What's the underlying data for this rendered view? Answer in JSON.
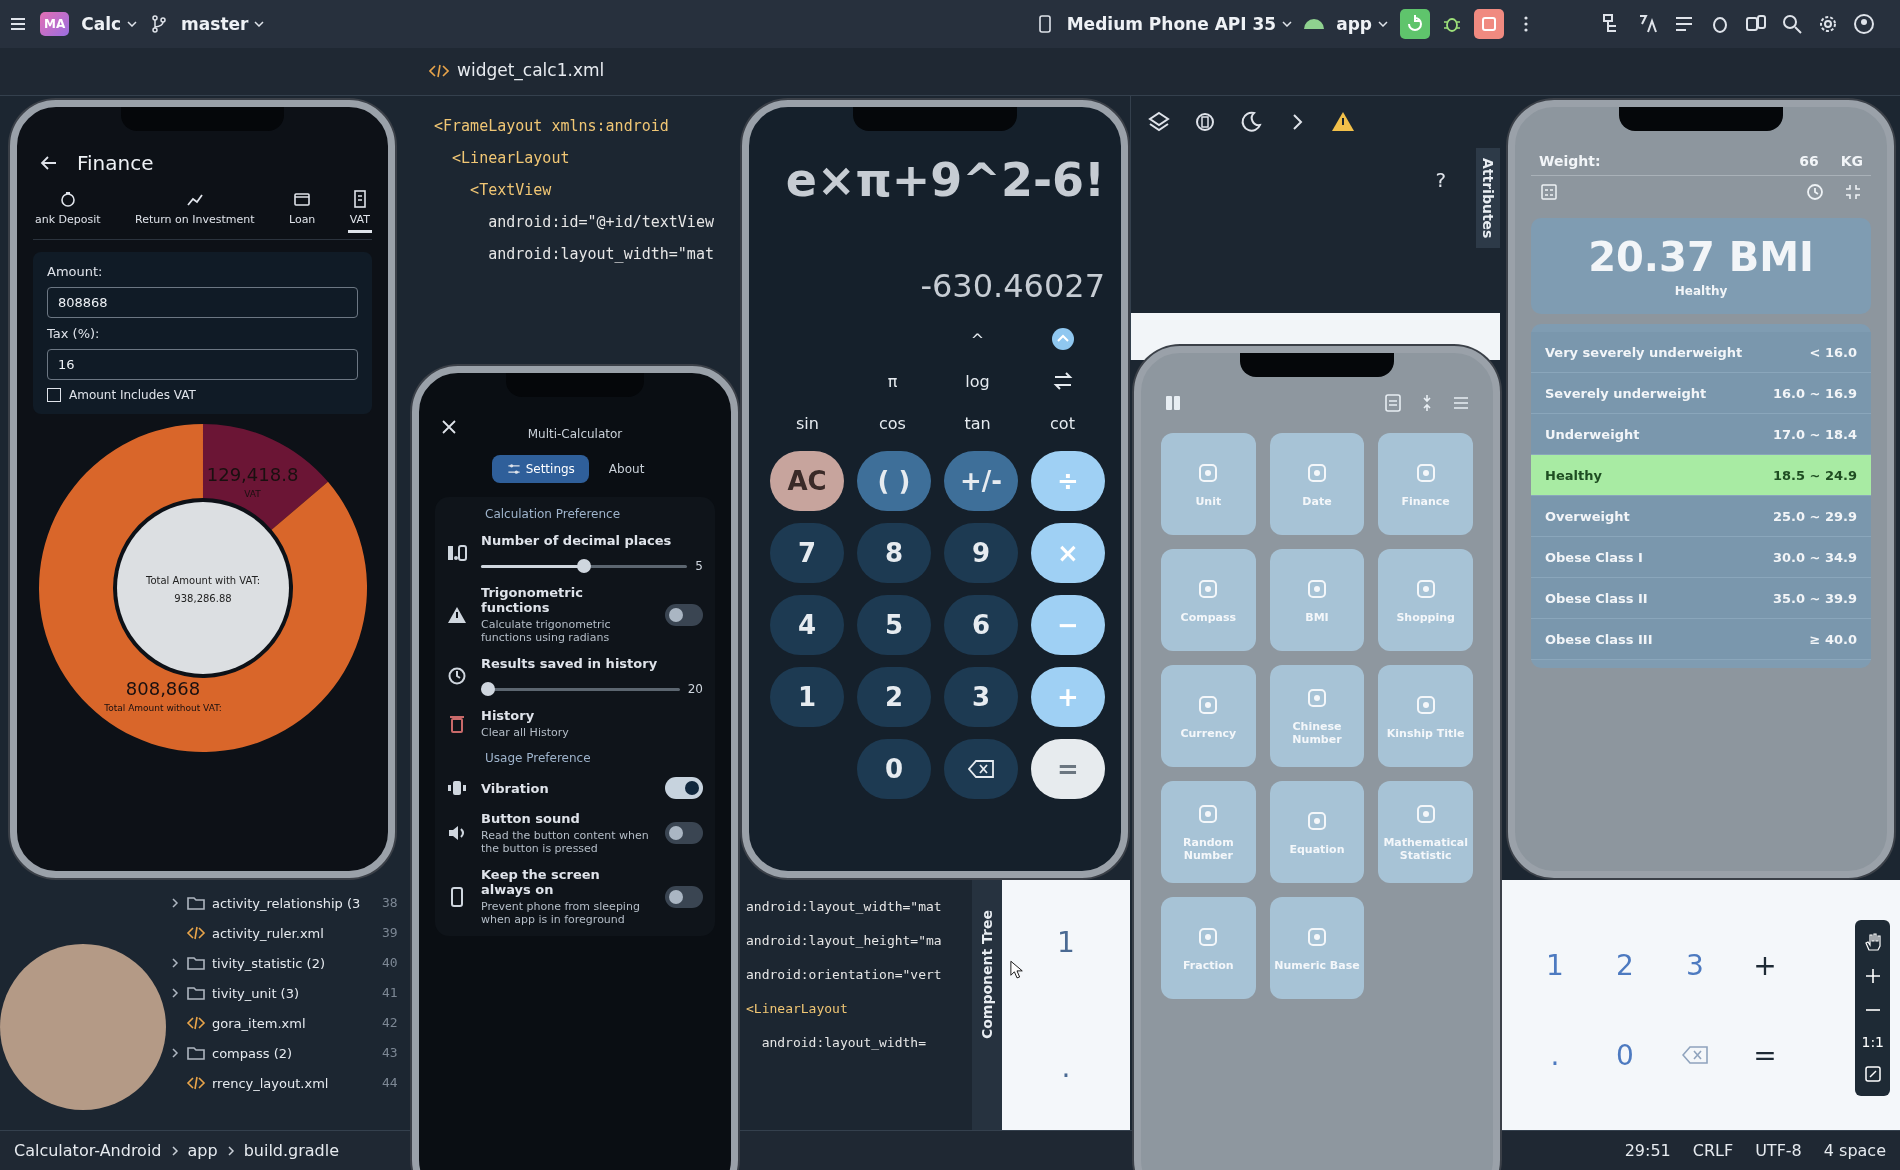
{
  "toolbar": {
    "project_badge": "MA",
    "project": "Calc",
    "branch": "master",
    "device": "Medium Phone API 35",
    "run_config": "app"
  },
  "editor_tabs": [
    {
      "label": "widget_calc1.xml",
      "selected": false
    }
  ],
  "code_top": [
    {
      "kind": "tag",
      "text": "<FrameLayout xmlns:android",
      "children": [
        {
          "kind": "tag",
          "text": "<LinearLayout",
          "children": [
            {
              "kind": "tag",
              "text": "<TextView",
              "children": [
                {
                  "kind": "attribute",
                  "text": "android:id=\"@+id/textView"
                },
                {
                  "kind": "attribute",
                  "text": "android:layout_width=\"mat"
                }
              ]
            }
          ]
        }
      ]
    }
  ],
  "design_toolbar": {
    "help": "?",
    "side_tab": "Attributes"
  },
  "project_tree": [
    {
      "kind": "folder",
      "name": "activity_relationship (3"
    },
    {
      "kind": "file",
      "name": "activity_ruler.xml"
    },
    {
      "kind": "folder",
      "name": "tivity_statistic (2)"
    },
    {
      "kind": "folder",
      "name": "tivity_unit (3)"
    },
    {
      "kind": "file",
      "name": "gora_item.xml"
    },
    {
      "kind": "folder",
      "name": "compass (2)"
    },
    {
      "kind": "file",
      "name": "rrency_layout.xml"
    }
  ],
  "line_numbers": [
    "38",
    "39",
    "40",
    "41",
    "42",
    "43",
    "44"
  ],
  "lower_code": [
    {
      "kind": "attribute",
      "text": "android:layout_width=\"mat"
    },
    {
      "kind": "attribute",
      "text": "android:layout_height=\"ma"
    },
    {
      "kind": "attribute",
      "text": "android:orientation=\"vert"
    },
    {
      "kind": "tag",
      "text": "<LinearLayout",
      "children": [
        {
          "kind": "attribute",
          "text": "android:layout_width="
        }
      ]
    }
  ],
  "component_tree": {
    "side_tab": "Component Tree"
  },
  "preview_digits": [
    "1",
    "."
  ],
  "device_keypad": [
    {
      "kind": "num",
      "label": "1"
    },
    {
      "kind": "num",
      "label": "2"
    },
    {
      "kind": "num",
      "label": "3"
    },
    {
      "kind": "op",
      "label": "+"
    },
    {
      "kind": "num",
      "label": "."
    },
    {
      "kind": "num",
      "label": "0"
    },
    {
      "kind": "backspace"
    },
    {
      "kind": "op",
      "label": "="
    }
  ],
  "zoom_controls": {
    "ratio": "1:1"
  },
  "status_bar": {
    "breadcrumbs": [
      "Calculator-Android",
      "app",
      "build.gradle"
    ],
    "info": [
      "29:51",
      "CRLF",
      "UTF-8",
      "4 space"
    ]
  },
  "finance": {
    "title": "Finance",
    "tabs": [
      {
        "label": "ank Deposit",
        "selected": false
      },
      {
        "label": "Return on Investment",
        "selected": false
      },
      {
        "label": "Loan",
        "selected": false
      },
      {
        "label": "VAT",
        "selected": true
      }
    ],
    "amount_label": "Amount:",
    "amount": "808868",
    "tax_label": "Tax (%):",
    "tax": "16",
    "includes_vat": {
      "label": "Amount Includes VAT",
      "checked": false
    },
    "chart_data": {
      "type": "donut",
      "values": [
        129418.8,
        808868
      ],
      "value_labels": [
        "129,418.8",
        "808,868"
      ]
    },
    "slice_captions": [
      "VAT",
      "Total Amount without VAT:"
    ],
    "center_label": "Total Amount with VAT:",
    "center_value": "938,286.88"
  },
  "settings": {
    "title": "Multi-Calculator",
    "segments": [
      {
        "label": "Settings",
        "selected": true
      },
      {
        "label": "About",
        "selected": false
      }
    ],
    "items": [
      {
        "kind": "section",
        "title": "Calculation Preference"
      },
      {
        "kind": "slider",
        "title": "Number of decimal places",
        "level": 0.5,
        "reading": "5"
      },
      {
        "kind": "toggle",
        "title": "Trigonometric functions",
        "subtitle": "Calculate trigonometric functions using radians",
        "on": false
      },
      {
        "kind": "slider",
        "title": "Results saved in history",
        "level": 0,
        "reading": "20"
      },
      {
        "kind": "action",
        "title": "History",
        "subtitle": "Clear all History"
      },
      {
        "kind": "section",
        "title": "Usage Preference"
      },
      {
        "kind": "toggle",
        "title": "Vibration",
        "on": true
      },
      {
        "kind": "toggle",
        "title": "Button sound",
        "subtitle": "Read the button content when the button is pressed",
        "on": false
      },
      {
        "kind": "toggle",
        "title": "Keep the screen always on",
        "subtitle": "Prevent phone from sleeping when app is in foreground",
        "on": false
      }
    ]
  },
  "calculator": {
    "expression": "e×π+9^2-6!",
    "result": "-630.46027",
    "sci_rows": [
      [
        {
          "kind": "text",
          "label": "^"
        },
        {
          "kind": "expand"
        }
      ],
      [
        {
          "kind": "text",
          "label": "π"
        },
        {
          "kind": "text",
          "label": "log"
        },
        {
          "kind": "swap"
        }
      ],
      [
        {
          "kind": "text",
          "label": "sin"
        },
        {
          "kind": "text",
          "label": "cos"
        },
        {
          "kind": "text",
          "label": "tan"
        },
        {
          "kind": "text",
          "label": "cot"
        }
      ]
    ],
    "key_rows": [
      [
        {
          "kind": "clear",
          "label": "AC"
        },
        {
          "kind": "func",
          "label": "( )"
        },
        {
          "kind": "func",
          "label": "+/-"
        },
        {
          "kind": "op",
          "label": "÷"
        }
      ],
      [
        {
          "kind": "num",
          "label": "7"
        },
        {
          "kind": "num",
          "label": "8"
        },
        {
          "kind": "num",
          "label": "9"
        },
        {
          "kind": "op",
          "label": "×"
        }
      ],
      [
        {
          "kind": "num",
          "label": "4"
        },
        {
          "kind": "num",
          "label": "5"
        },
        {
          "kind": "num",
          "label": "6"
        },
        {
          "kind": "op",
          "label": "−"
        }
      ],
      [
        {
          "kind": "num",
          "label": "1"
        },
        {
          "kind": "num",
          "label": "2"
        },
        {
          "kind": "num",
          "label": "3"
        },
        {
          "kind": "op",
          "label": "+"
        }
      ],
      [
        {
          "kind": "num",
          "label": "0"
        },
        {
          "kind": "backspace"
        },
        {
          "kind": "equals",
          "label": "="
        }
      ]
    ]
  },
  "menu": {
    "tiles": [
      "Unit",
      "Date",
      "Finance",
      "Compass",
      "BMI",
      "Shopping",
      "Currency",
      "Chinese Number",
      "Kinship Title",
      "Random Number",
      "Equation",
      "Mathematical Statistic",
      "Fraction",
      "Numeric Base"
    ]
  },
  "bmi": {
    "weight_label": "Weight:",
    "weight": "66",
    "unit": "KG",
    "value": "20.37 BMI",
    "status": "Healthy",
    "ranges": [
      {
        "name": "Very severely underweight",
        "range": "< 16.0",
        "selected": false
      },
      {
        "name": "Severely underweight",
        "range": "16.0 ~ 16.9",
        "selected": false
      },
      {
        "name": "Underweight",
        "range": "17.0 ~ 18.4",
        "selected": false
      },
      {
        "name": "Healthy",
        "range": "18.5 ~ 24.9",
        "selected": true
      },
      {
        "name": "Overweight",
        "range": "25.0 ~ 29.9",
        "selected": false
      },
      {
        "name": "Obese Class I",
        "range": "30.0 ~ 34.9",
        "selected": false
      },
      {
        "name": "Obese Class II",
        "range": "35.0 ~ 39.9",
        "selected": false
      },
      {
        "name": "Obese Class III",
        "range": "≥ 40.0",
        "selected": false
      }
    ]
  }
}
